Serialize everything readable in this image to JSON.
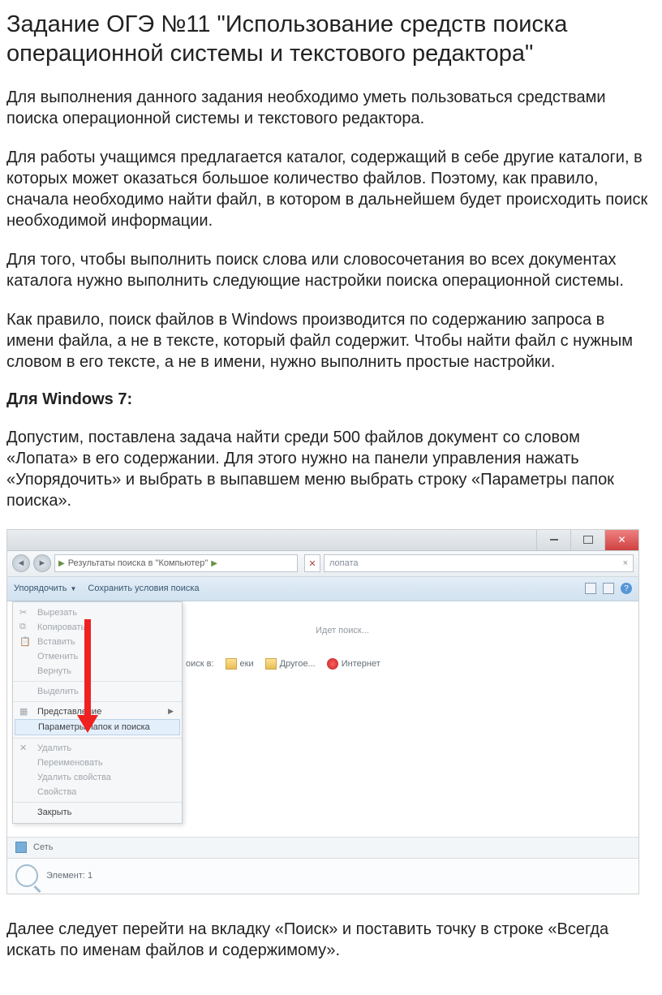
{
  "title": "Задание ОГЭ №11 \"Использование средств поиска операционной системы и текстового редактора\"",
  "p1": "Для выполнения данного задания необходимо уметь пользоваться средствами поиска операционной системы и текстового редактора.",
  "p2": "Для работы учащимся предлагается каталог, содержащий в себе другие каталоги, в которых может оказаться большое количество файлов. Поэтому, как правило, сначала необходимо найти файл, в котором в дальнейшем будет происходить поиск необходимой информации.",
  "p3": "Для того, чтобы выполнить поиск слова или словосочетания во всех документах каталога нужно выполнить следующие настройки поиска операционной системы.",
  "p4": "Как правило, поиск файлов в Windows производится по содержанию запроса в имени файла, а не в тексте, который файл содержит. Чтобы найти файл с нужным словом в его тексте, а не в имени, нужно выполнить простые настройки.",
  "h_win7": "Для Windows 7:",
  "p5": "Допустим, поставлена задача найти среди 500 файлов документ со словом «Лопата» в его содержании. Для этого нужно на панели управления нажать «Упорядочить» и выбрать в выпавшем меню выбрать строку «Параметры папок  поиска».",
  "p6": "Далее следует перейти на вкладку «Поиск» и поставить точку в строке «Всегда искать по именам файлов и содержимому».",
  "win7": {
    "addr_prefix": "▸",
    "addr_text": "Результаты поиска в \"Компьютер\"",
    "search_value": "лопата",
    "toolbar": {
      "organize": "Упорядочить",
      "save_search": "Сохранить условия поиска"
    },
    "searching_text": "Идет поиск...",
    "search_in_label": "оиск в:",
    "loc_lib": "еки",
    "loc_other": "Другое...",
    "loc_internet": "Интернет",
    "footer_net": "Сеть",
    "footer_count": "Элемент: 1",
    "menu": {
      "cut": "Вырезать",
      "copy": "Копировать",
      "paste": "Вставить",
      "undo": "Отменить",
      "redo": "Вернуть",
      "selectall": "Выделить",
      "view": "Представление",
      "folderopts": "Параметры папок и поиска",
      "delete": "Удалить",
      "rename": "Переименовать",
      "removeprops": "Удалить свойства",
      "props": "Свойства",
      "close": "Закрыть"
    }
  }
}
